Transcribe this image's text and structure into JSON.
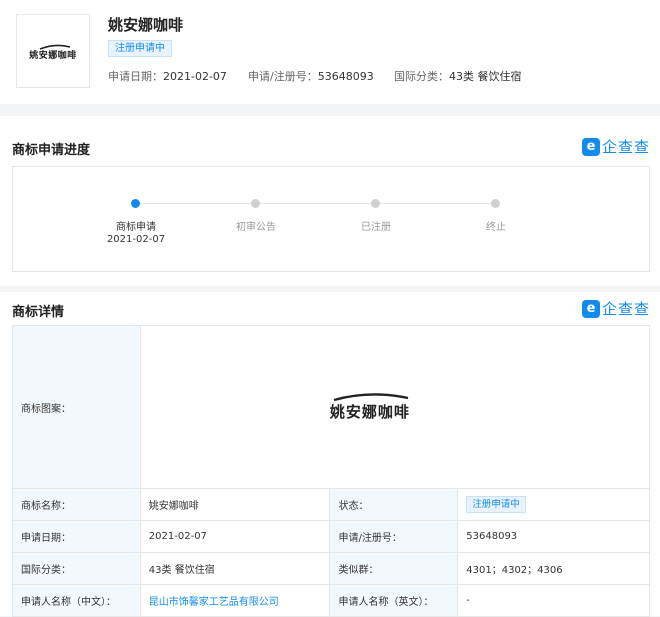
{
  "header": {
    "logo_text": "姚安娜咖啡",
    "title": "姚安娜咖啡",
    "status_badge": "注册申请中",
    "apply_date_label": "申请日期：",
    "apply_date": "2021-02-07",
    "reg_no_label": "申请/注册号：",
    "reg_no": "53648093",
    "intl_class_label": "国际分类：",
    "intl_class": "43类 餐饮住宿"
  },
  "brand": {
    "icon_char": "e",
    "name": "企查查",
    "color": "#128bed"
  },
  "progress": {
    "title": "商标申请进度",
    "steps": [
      {
        "label": "商标申请",
        "date": "2021-02-07"
      },
      {
        "label": "初审公告",
        "date": ""
      },
      {
        "label": "已注册",
        "date": ""
      },
      {
        "label": "终止",
        "date": ""
      }
    ],
    "current_step": 0
  },
  "details": {
    "title": "商标详情",
    "image_label": "商标图案：",
    "image_text": "姚安娜咖啡",
    "name_label": "商标名称：",
    "name_value": "姚安娜咖啡",
    "status_label": "状态：",
    "status_value": "注册申请中",
    "apply_date_label": "申请日期：",
    "apply_date_value": "2021-02-07",
    "reg_no_label": "申请/注册号：",
    "reg_no_value": "53648093",
    "intl_class_label": "国际分类：",
    "intl_class_value": "43类 餐饮住宿",
    "similar_group_label": "类似群：",
    "similar_group_value": "4301；4302；4306",
    "applicant_cn_label": "申请人名称（中文）：",
    "applicant_cn_value": "昆山市饰馨家工艺品有限公司",
    "applicant_en_label": "申请人名称（英文）：",
    "applicant_en_value": "-"
  }
}
